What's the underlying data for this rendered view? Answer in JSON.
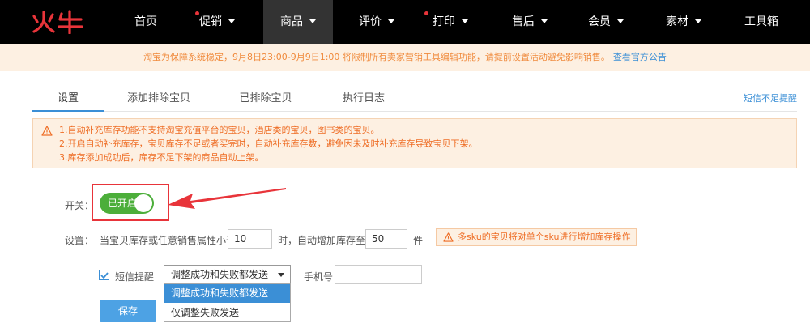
{
  "brand": {
    "logo_text": "火牛",
    "logo_color": "#e8343a"
  },
  "nav": {
    "items": [
      {
        "label": "首页",
        "dot": false,
        "caret": false,
        "active": false
      },
      {
        "label": "促销",
        "dot": true,
        "caret": true,
        "active": false
      },
      {
        "label": "商品",
        "dot": false,
        "caret": true,
        "active": true
      },
      {
        "label": "评价",
        "dot": false,
        "caret": true,
        "active": false
      },
      {
        "label": "打印",
        "dot": true,
        "caret": true,
        "active": false
      },
      {
        "label": "售后",
        "dot": false,
        "caret": true,
        "active": false
      },
      {
        "label": "会员",
        "dot": false,
        "caret": true,
        "active": false
      },
      {
        "label": "素材",
        "dot": false,
        "caret": true,
        "active": false
      },
      {
        "label": "工具箱",
        "dot": false,
        "caret": false,
        "active": false
      }
    ]
  },
  "notice": {
    "text": "淘宝为保障系统稳定，9月8日23:00-9月9日1:00 将限制所有卖家营销工具编辑功能，请提前设置活动避免影响销售。",
    "link": "查看官方公告"
  },
  "tabs": {
    "items": [
      "设置",
      "添加排除宝贝",
      "已排除宝贝",
      "执行日志"
    ],
    "active_index": 0,
    "right_link": "短信不足提醒"
  },
  "warning": {
    "lines": [
      "1.自动补充库存功能不支持淘宝充值平台的宝贝，酒店类的宝贝，图书类的宝贝。",
      "2.开启自动补充库存，宝贝库存不足或者买完时，自动补充库存数，避免因未及时补充库存导致宝贝下架。",
      "3.库存添加成功后，库存不足下架的商品自动上架。"
    ]
  },
  "switch": {
    "label": "开关：",
    "state_text": "已开启",
    "on": true
  },
  "setting": {
    "label": "设置：",
    "text_before": "当宝贝库存或任意销售属性小于",
    "threshold_value": "10",
    "text_middle": "时，自动增加库存至",
    "target_value": "50",
    "text_after": "件",
    "tip": "多sku的宝贝将对单个sku进行增加库存操作"
  },
  "sms": {
    "checkbox_label": "短信提醒",
    "checked": true,
    "select_value": "调整成功和失败都发送",
    "options": [
      "调整成功和失败都发送",
      "仅调整失败发送"
    ],
    "highlighted_option": 0,
    "phone_label": "手机号",
    "phone_value": ""
  },
  "save_label": "保存",
  "colors": {
    "accent": "#3b8fd6",
    "warning": "#ee6d25",
    "switch_on": "#4cae3a",
    "highlight_box": "#e8343a"
  }
}
